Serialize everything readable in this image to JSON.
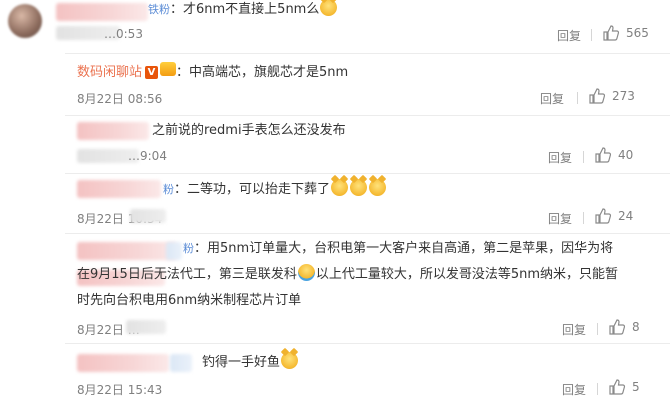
{
  "comments": [
    {
      "text_head": "铁粉",
      "text": "：才6nm不直接上5nm么",
      "time": "…0:53",
      "reply": "回复",
      "likes": "565"
    },
    {
      "username": "数码闲聊站",
      "v_badge": "V",
      "text": "：中高端芯，旗舰芯才是5nm",
      "time": "8月22日 08:56",
      "reply": "回复",
      "likes": "273"
    },
    {
      "text": "之前说的redmi手表怎么还没发布",
      "time": "…9:04",
      "reply": "回复",
      "likes": "40"
    },
    {
      "text_head": "粉",
      "text": "：二等功，可以抬走下葬了",
      "time": "8月22日 10:34",
      "reply": "回复",
      "likes": "24"
    },
    {
      "text_head": "粉",
      "text_line1": "：用5nm订单量大，台积电第一大客户来自高通，第二是苹果，因华为将",
      "text_line2a": "在9月15日后无法代工，第三是联发科",
      "text_line2b": "以上代工量较大，所以发哥没法等5nm纳米，只能暂",
      "text_line3": "时先向台积电用6nm纳米制程芯片订单",
      "time": "8月22日 …",
      "reply": "回复",
      "likes": "8"
    },
    {
      "text": "钓得一手好鱼",
      "time": "8月22日 15:43",
      "reply": "回复",
      "likes": "5"
    }
  ]
}
